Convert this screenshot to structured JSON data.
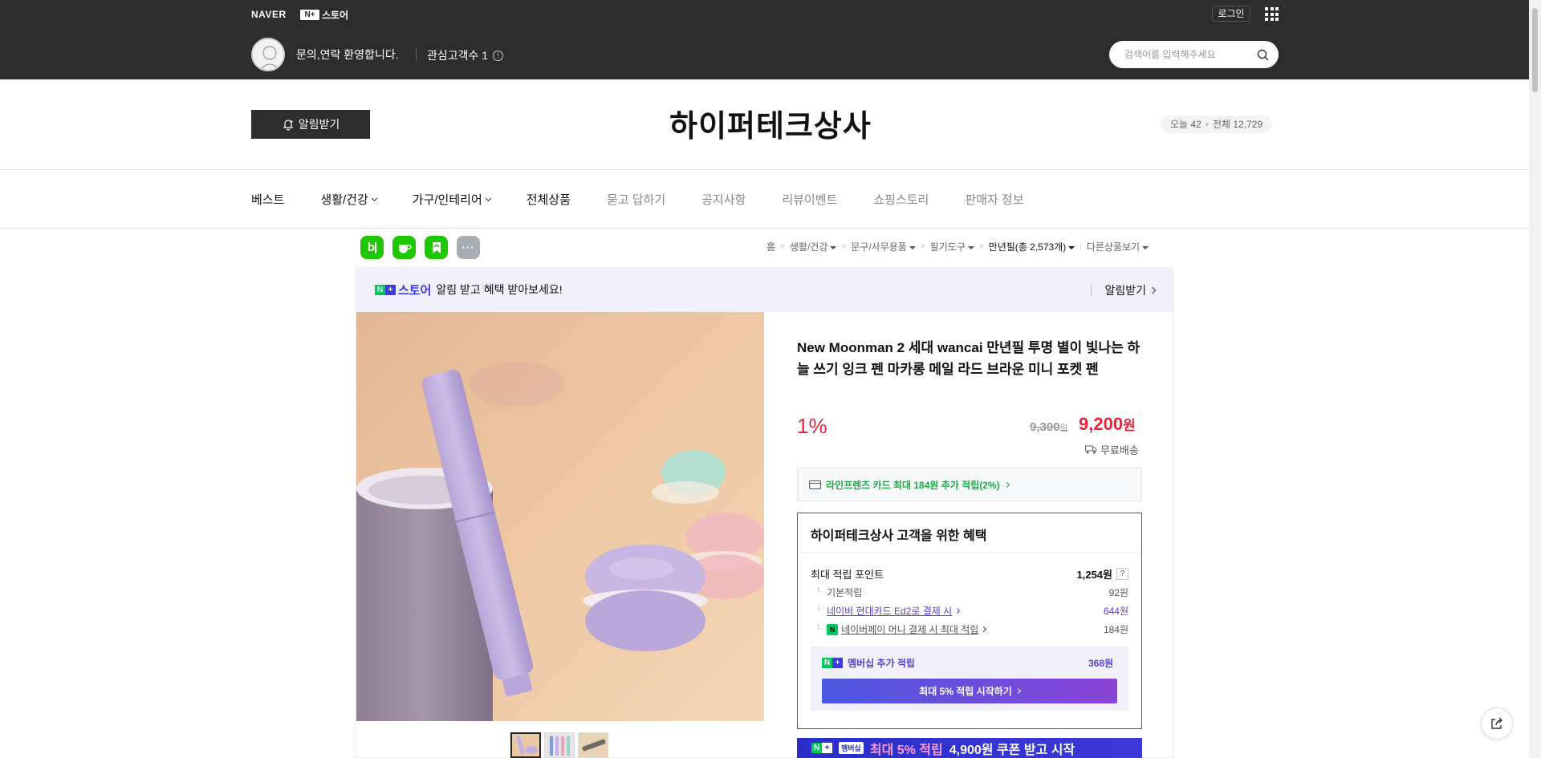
{
  "global_header": {
    "naver_label": "NAVER",
    "nplus_badge": "N+",
    "nplus_store_label": "스토어",
    "login_label": "로그인",
    "welcome_text": "문의,연락 환영합니다.",
    "interest_label": "관심고객수 1",
    "search_placeholder": "검색어를 입력해주세요"
  },
  "store_header": {
    "notify_label": "알림받기",
    "store_name": "하이퍼테크상사",
    "visitor_today": "오늘 42",
    "visitor_total": "전체 12,729"
  },
  "nav": {
    "items": [
      {
        "label": "베스트"
      },
      {
        "label": "생활/건강"
      },
      {
        "label": "가구/인테리어"
      },
      {
        "label": "전체상품"
      },
      {
        "label": "묻고 답하기"
      },
      {
        "label": "공지사항"
      },
      {
        "label": "리뷰이벤트"
      },
      {
        "label": "쇼핑스토리"
      },
      {
        "label": "판매자 정보"
      }
    ]
  },
  "share_icons": [
    {
      "name": "blog",
      "glyph": "b|",
      "color": "#1ec800"
    },
    {
      "name": "cafe",
      "glyph": "☕",
      "color": "#1ec800"
    },
    {
      "name": "bookmark",
      "glyph": "",
      "color": "#1ec800"
    },
    {
      "name": "more",
      "glyph": "···",
      "color": "#a8adb4"
    }
  ],
  "breadcrumb": {
    "items": [
      "홈",
      "생활/건강",
      "문구/사무용품",
      "필기도구"
    ],
    "current": "만년필(총 2,573개)",
    "other": "다른상품보기"
  },
  "notice_banner": {
    "logo_label": "스토어",
    "text": "알림 받고 혜택 받아보세요!",
    "action": "알림받기"
  },
  "product": {
    "title": "New Moonman 2 세대 wancai 만년필 투명 별이 빛나는 하늘 쓰기 잉크 펜 마카롱 메일 라드 브라운 미니 포켓 펜",
    "discount": "1%",
    "original_price": "9,300",
    "original_unit": "원",
    "price": "9,200",
    "price_unit": "원",
    "shipping": "무료배송",
    "card_offer": "라인프렌즈 카드 최대 184원 추가 적립(2%)"
  },
  "benefits": {
    "title": "하이퍼테크상사 고객을 위한 혜택",
    "max_points_label": "최대 적립 포인트",
    "max_points_value": "1,254원",
    "help": "?",
    "rows": [
      {
        "label": "기본적립",
        "value": "92원"
      },
      {
        "label": "네이버 현대카드 Ed2로 결제 시",
        "value": "644원"
      },
      {
        "label": "네이버페이 머니 결제 시 최대 적립",
        "value": "184원"
      }
    ],
    "membership_label": "멤버십 추가 적립",
    "membership_value": "368원",
    "membership_button": "최대 5% 적립 시작하기"
  },
  "promo": {
    "tag": "멤버십",
    "highlight": "최대 5% 적립",
    "text": "4,900원 쿠폰 받고 시작"
  },
  "colors": {
    "header_bg": "#2d2d2d",
    "price_red": "#e5263b",
    "naver_green": "#03c75a",
    "membership_purple": "#5a3ed0"
  }
}
